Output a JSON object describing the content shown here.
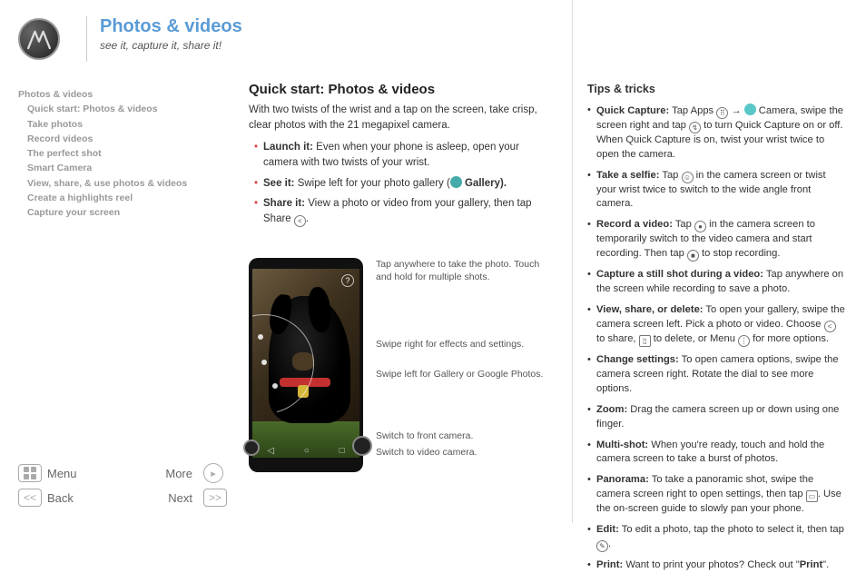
{
  "header": {
    "title": "Photos & videos",
    "tagline": "see it, capture it, share it!"
  },
  "toc": {
    "section": "Photos & videos",
    "items": [
      "Quick start: Photos & videos",
      "Take photos",
      "Record videos",
      "The perfect shot",
      "Smart Camera",
      "View, share, & use photos & videos",
      "Create a highlights reel",
      "Capture your screen"
    ]
  },
  "footer": {
    "menu": "Menu",
    "more": "More",
    "back": "Back",
    "next": "Next"
  },
  "mid": {
    "heading": "Quick start: Photos & videos",
    "intro": "With two twists of the wrist and a tap on the screen, take crisp, clear photos with the 21 megapixel camera.",
    "bullets": [
      {
        "label": "Launch it:",
        "text": " Even when your phone is asleep, open your camera with two twists of your wrist."
      },
      {
        "label": "See it:",
        "text": " Swipe left for your photo gallery (",
        "icon": "gallery",
        "tail": " Gallery)."
      },
      {
        "label": "Share it:",
        "text": " View a photo or video from your gallery, then tap Share ",
        "icon": "share",
        "tail": "."
      }
    ],
    "callouts": {
      "c1": "Tap anywhere to take the photo. Touch and hold for multiple shots.",
      "c2": "Swipe right for effects and settings.",
      "c3": "Swipe left for Gallery or Google Photos.",
      "c4": "Switch to front camera.",
      "c5": "Switch to video camera."
    },
    "help_glyph": "?"
  },
  "tips": {
    "heading": "Tips & tricks",
    "items": [
      {
        "label": "Quick Capture:",
        "pre": " Tap Apps ",
        "i1": "dots",
        "mid1": " → ",
        "i2": "cam",
        "mid2": " Camera, swipe the screen right and tap ",
        "i3": "wand",
        "post": " to turn Quick Capture on or off. When Quick Capture is on, twist your wrist twice to open the camera."
      },
      {
        "label": "Take a selfie:",
        "pre": " Tap ",
        "i1": "selfie",
        "post": " in the camera screen or twist your wrist twice to switch to the wide angle front camera."
      },
      {
        "label": "Record a video:",
        "pre": " Tap ",
        "i1": "rec",
        "mid1": " in the camera screen to temporarily switch to the video camera and start recording. Then tap ",
        "i2": "stop",
        "post": " to stop recording."
      },
      {
        "label": "Capture a still shot during a video:",
        "post": " Tap anywhere on the screen while recording to save a photo."
      },
      {
        "label": "View, share, or delete:",
        "pre": " To open your gallery, swipe the camera screen left. Pick a photo or video. Choose ",
        "i1": "share",
        "mid1": " to share, ",
        "i2": "trash",
        "mid2": " to delete, or Menu ",
        "i3": "menu",
        "post": " for more options."
      },
      {
        "label": "Change settings:",
        "post": " To open camera options, swipe the camera screen right. Rotate the dial to see more options."
      },
      {
        "label": "Zoom:",
        "post": " Drag the camera screen up or down using one finger."
      },
      {
        "label": "Multi-shot:",
        "post": " When you're ready, touch and hold the camera screen to take a burst of photos."
      },
      {
        "label": "Panorama:",
        "pre": " To take a panoramic shot, swipe the camera screen right to open settings, then tap ",
        "i1": "pano",
        "post": ". Use the on-screen guide to slowly pan your phone."
      },
      {
        "label": "Edit:",
        "pre": " To edit a photo, tap the photo to select it, then tap ",
        "i1": "pencil",
        "post": "."
      },
      {
        "label": "Print:",
        "pre": " Want to print your photos? Check out \"",
        "bold": "Print",
        "post": "\"."
      }
    ]
  }
}
